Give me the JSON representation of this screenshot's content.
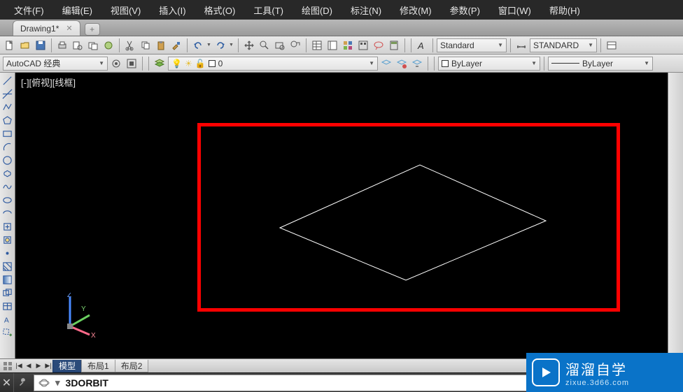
{
  "menu": {
    "file": "文件(F)",
    "edit": "编辑(E)",
    "view": "视图(V)",
    "insert": "插入(I)",
    "format": "格式(O)",
    "tools": "工具(T)",
    "draw": "绘图(D)",
    "dimension": "标注(N)",
    "modify": "修改(M)",
    "params": "参数(P)",
    "window": "窗口(W)",
    "help": "帮助(H)"
  },
  "tabs": {
    "active": "Drawing1*"
  },
  "row2": {
    "workspace": "AutoCAD 经典",
    "layer_current": "0",
    "layer_combo": "ByLayer",
    "linetype_combo": "ByLayer"
  },
  "row1": {
    "textstyle": "Standard",
    "dimstyle": "STANDARD"
  },
  "canvas": {
    "label": "[-][俯视][线框]"
  },
  "bottom": {
    "model": "模型",
    "layout1": "布局1",
    "layout2": "布局2"
  },
  "command": {
    "text": "3DORBIT"
  },
  "watermark": {
    "title": "溜溜自学",
    "url": "zixue.3d66.com"
  }
}
